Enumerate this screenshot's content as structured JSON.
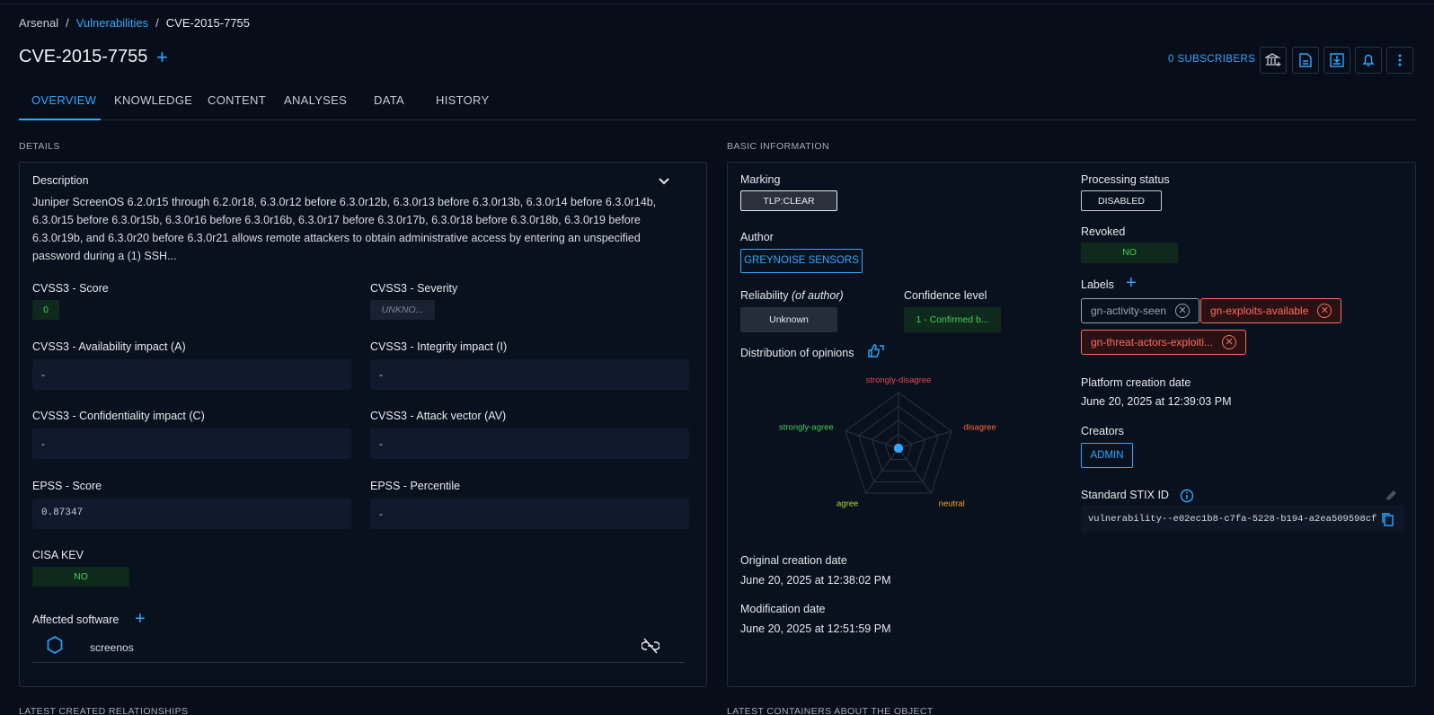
{
  "breadcrumb": {
    "root": "Arsenal",
    "sep1": "/",
    "section": "Vulnerabilities",
    "sep2": "/",
    "current": "CVE-2015-7755"
  },
  "header": {
    "title": "CVE-2015-7755",
    "add_icon": "+",
    "subscribers": "0 SUBSCRIBERS"
  },
  "toolbar_icons": [
    "bank-plus-icon",
    "file-pdf-icon",
    "download-icon",
    "bell-icon",
    "more-vertical-icon"
  ],
  "tabs": [
    {
      "label": "OVERVIEW",
      "active": true
    },
    {
      "label": "KNOWLEDGE"
    },
    {
      "label": "CONTENT"
    },
    {
      "label": "ANALYSES"
    },
    {
      "label": "DATA"
    },
    {
      "label": "HISTORY"
    }
  ],
  "details": {
    "section_title": "DETAILS",
    "description_label": "Description",
    "description": "Juniper ScreenOS 6.2.0r15 through 6.2.0r18, 6.3.0r12 before 6.3.0r12b, 6.3.0r13 before 6.3.0r13b, 6.3.0r14 before 6.3.0r14b, 6.3.0r15 before 6.3.0r15b, 6.3.0r16 before 6.3.0r16b, 6.3.0r17 before 6.3.0r17b, 6.3.0r18 before 6.3.0r18b, 6.3.0r19 before 6.3.0r19b, and 6.3.0r20 before 6.3.0r21 allows remote attackers to obtain administrative access by entering an unspecified password during a (1) SSH...",
    "cvss3_score_label": "CVSS3 - Score",
    "cvss3_score": "0",
    "cvss3_severity_label": "CVSS3 - Severity",
    "cvss3_severity": "UNKNO...",
    "availability_label": "CVSS3 - Availability impact (A)",
    "availability": "-",
    "integrity_label": "CVSS3 - Integrity impact (I)",
    "integrity": "-",
    "confidentiality_label": "CVSS3 - Confidentiality impact (C)",
    "confidentiality": "-",
    "attack_vector_label": "CVSS3 - Attack vector (AV)",
    "attack_vector": "-",
    "epss_score_label": "EPSS - Score",
    "epss_score": "0.87347",
    "epss_percentile_label": "EPSS - Percentile",
    "epss_percentile": "-",
    "cisa_kev_label": "CISA KEV",
    "cisa_kev": "NO",
    "affected_software_label": "Affected software",
    "affected_software": [
      {
        "name": "screenos"
      }
    ]
  },
  "basic": {
    "section_title": "BASIC INFORMATION",
    "marking_label": "Marking",
    "marking": "TLP:CLEAR",
    "author_label": "Author",
    "author": "GREYNOISE SENSORS",
    "reliability_label": "Reliability",
    "reliability_suffix": "(of author)",
    "reliability": "Unknown",
    "confidence_label": "Confidence level",
    "confidence": "1 - Confirmed b...",
    "opinions_label": "Distribution of opinions",
    "processing_label": "Processing status",
    "processing": "DISABLED",
    "revoked_label": "Revoked",
    "revoked": "NO",
    "labels_label": "Labels",
    "labels": [
      {
        "text": "gn-activity-seen",
        "color": "#9aa0a8"
      },
      {
        "text": "gn-exploits-available",
        "color": "#ff6b5b"
      },
      {
        "text": "gn-threat-actors-exploiti...",
        "color": "#ff6b5b"
      }
    ],
    "platform_creation_label": "Platform creation date",
    "platform_creation": "June 20, 2025 at 12:39:03 PM",
    "creators_label": "Creators",
    "creator": "ADMIN",
    "stix_label": "Standard STIX ID",
    "stix_id": "vulnerability--e02ec1b8-c7fa-5228-b194-a2ea509598cf",
    "original_creation_label": "Original creation date",
    "original_creation": "June 20, 2025 at 12:38:02 PM",
    "modification_label": "Modification date",
    "modification": "June 20, 2025 at 12:51:59 PM"
  },
  "chart_data": {
    "type": "radar",
    "categories": [
      "strongly-disagree",
      "disagree",
      "neutral",
      "agree",
      "strongly-agree"
    ],
    "category_colors": [
      "#e5484d",
      "#f76b3c",
      "#f5a623",
      "#b5d334",
      "#3fcf5a"
    ],
    "values": [
      0,
      0,
      0,
      0,
      0
    ]
  },
  "bottom": {
    "left_title": "LATEST CREATED RELATIONSHIPS",
    "right_title": "LATEST CONTAINERS ABOUT THE OBJECT"
  }
}
